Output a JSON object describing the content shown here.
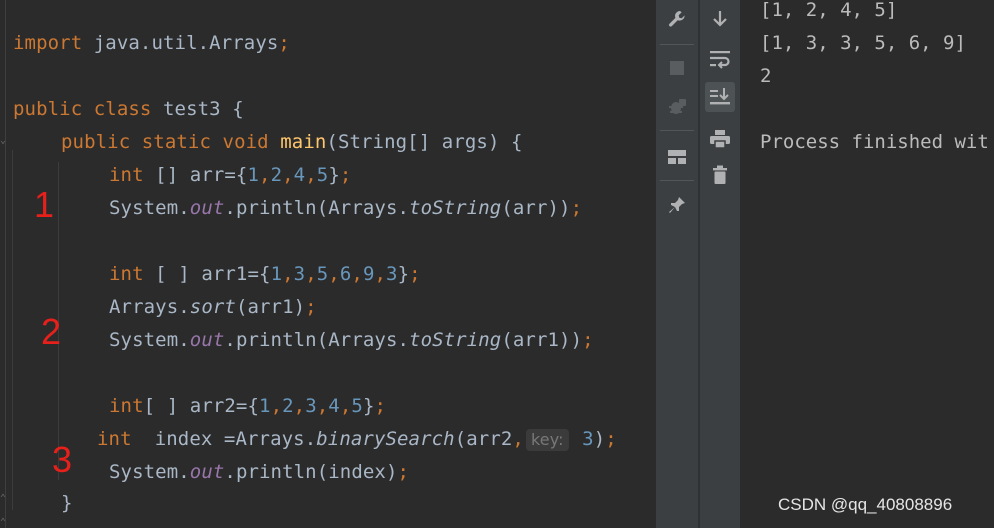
{
  "editor": {
    "lines": {
      "l1": {
        "kw_import": "import",
        "rest": " java.util.Arrays",
        "semi": ";"
      },
      "l3": {
        "kw_public": "public",
        "kw_class": " class",
        "name": " test3 {"
      },
      "l4": {
        "kw": "public static void ",
        "fn": "main",
        "rest": "(String[] args) {"
      },
      "l5": {
        "kw": "int",
        "rest": " [] arr={",
        "n1": "1",
        "c1": ",",
        "n2": "2",
        "c2": ",",
        "n3": "4",
        "c3": ",",
        "n4": "5",
        "end": "}",
        "semi": ";"
      },
      "l6": {
        "a": "System.",
        "field": "out",
        "b": ".println(Arrays.",
        "static": "toString",
        "c": "(arr))",
        "semi": ";"
      },
      "l8": {
        "kw": "int",
        "rest": " [ ] arr1={",
        "n1": "1",
        "c1": ",",
        "n2": "3",
        "c2": ",",
        "n3": "5",
        "c3": ",",
        "n4": "6",
        "c4": ",",
        "n5": "9",
        "c5": ",",
        "n6": "3",
        "end": "}",
        "semi": ";"
      },
      "l9": {
        "a": "Arrays.",
        "static": "sort",
        "b": "(arr1)",
        "semi": ";"
      },
      "l10": {
        "a": "System.",
        "field": "out",
        "b": ".println(Arrays.",
        "static": "toString",
        "c": "(arr1))",
        "semi": ";"
      },
      "l12": {
        "kw": "int",
        "rest": "[ ] arr2={",
        "n1": "1",
        "c1": ",",
        "n2": "2",
        "c2": ",",
        "n3": "3",
        "c3": ",",
        "n4": "4",
        "c4": ",",
        "n5": "5",
        "end": "}",
        "semi": ";"
      },
      "l13": {
        "kw": "int",
        "a": "  index =Arrays.",
        "static": "binarySearch",
        "b": "(arr2",
        "comma": ",",
        "hint": "key:",
        "n": " 3",
        "c": ")",
        "semi": ";"
      },
      "l14": {
        "a": "System.",
        "field": "out",
        "b": ".println(index)",
        "semi": ";"
      },
      "l15": {
        "close": "}"
      }
    },
    "annotations": {
      "a1": "1",
      "a2": "2",
      "a3": "3"
    }
  },
  "toolbar": {
    "left": [
      "wrench-icon",
      "stop-icon",
      "debug-icon",
      "layout-icon",
      "pin-icon"
    ],
    "right": [
      "down-arrow-icon",
      "soft-wrap-icon",
      "scroll-to-end-icon",
      "print-icon",
      "trash-icon"
    ]
  },
  "console": {
    "line1": "[1, 2, 4, 5]",
    "line2": "[1, 3, 3, 5, 6, 9]",
    "line3": "2",
    "line4": "Process finished wit"
  },
  "watermark": "CSDN @qq_40808896",
  "colors": {
    "background": "#2b2b2b",
    "keyword": "#cc7832",
    "function": "#ffc66d",
    "number": "#6897bb",
    "field": "#9876aa",
    "annotation": "#e8201b"
  }
}
